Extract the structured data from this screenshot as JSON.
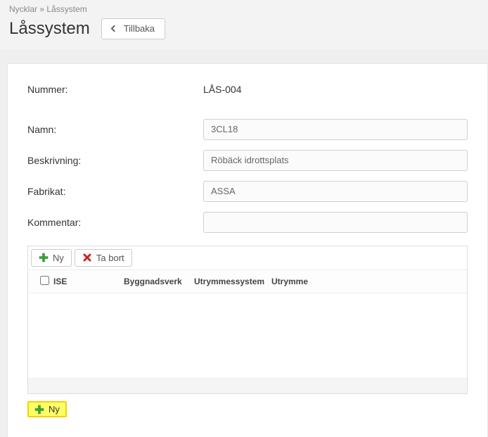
{
  "breadcrumb": {
    "part1": "Nycklar",
    "sep": " » ",
    "part2": "Låssystem"
  },
  "title": "Låssystem",
  "back_label": "Tillbaka",
  "form": {
    "nummer_label": "Nummer:",
    "nummer_value": "LÅS-004",
    "namn_label": "Namn:",
    "namn_value": "3CL18",
    "beskrivning_label": "Beskrivning:",
    "beskrivning_value": "Röbäck idrottsplats",
    "fabrikat_label": "Fabrikat:",
    "fabrikat_value": "ASSA",
    "kommentar_label": "Kommentar:",
    "kommentar_value": ""
  },
  "toolbar": {
    "ny_label": "Ny",
    "delete_label": "Ta bort"
  },
  "grid": {
    "col_ise": "ISE",
    "col_bygg": "Byggnadsverk",
    "col_utry": "Utrymmessystem",
    "col_utry2": "Utrymme"
  },
  "bottom": {
    "ny_label": "Ny"
  }
}
